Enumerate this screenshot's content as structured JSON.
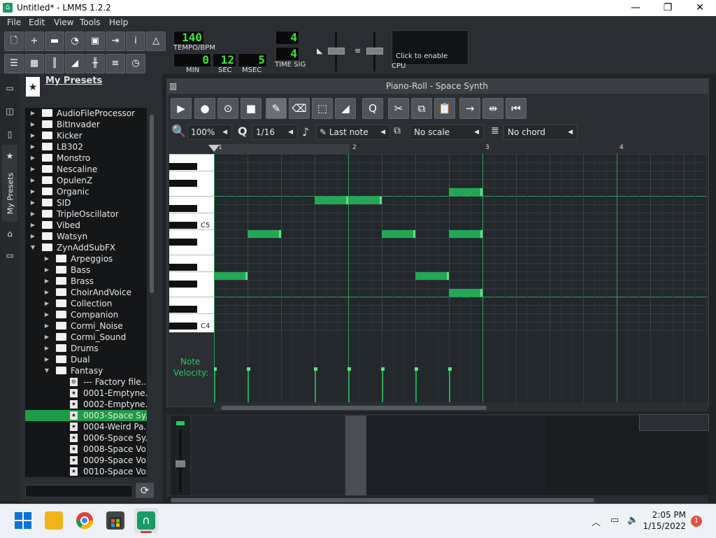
{
  "window": {
    "title": "Untitled* - LMMS 1.2.2",
    "minimize": "—",
    "maximize": "❐",
    "close": "✕"
  },
  "menu": [
    "File",
    "Edit",
    "View",
    "Tools",
    "Help"
  ],
  "transport": {
    "tempo_value": "140",
    "tempo_label": "TEMPO/BPM",
    "min_value": "0",
    "min_label": "MIN",
    "sec_value": "12",
    "sec_label": "SEC",
    "msec_value": "5",
    "msec_label": "MSEC",
    "timesig_num": "4",
    "timesig_den": "4",
    "timesig_label": "TIME SIG",
    "cpu_hint": "Click to enable",
    "cpu_label": "CPU"
  },
  "presets_panel": {
    "title": "My Presets",
    "sidetab_label": "My Presets"
  },
  "tree": [
    {
      "type": "folder",
      "name": "AudioFileProcessor",
      "level": 0,
      "expanded": false
    },
    {
      "type": "folder",
      "name": "BitInvader",
      "level": 0,
      "expanded": false
    },
    {
      "type": "folder",
      "name": "Kicker",
      "level": 0,
      "expanded": false
    },
    {
      "type": "folder",
      "name": "LB302",
      "level": 0,
      "expanded": false
    },
    {
      "type": "folder",
      "name": "Monstro",
      "level": 0,
      "expanded": false
    },
    {
      "type": "folder",
      "name": "Nescaline",
      "level": 0,
      "expanded": false
    },
    {
      "type": "folder",
      "name": "OpulenZ",
      "level": 0,
      "expanded": false
    },
    {
      "type": "folder",
      "name": "Organic",
      "level": 0,
      "expanded": false
    },
    {
      "type": "folder",
      "name": "SID",
      "level": 0,
      "expanded": false
    },
    {
      "type": "folder",
      "name": "TripleOscillator",
      "level": 0,
      "expanded": false
    },
    {
      "type": "folder",
      "name": "Vibed",
      "level": 0,
      "expanded": false
    },
    {
      "type": "folder",
      "name": "Watsyn",
      "level": 0,
      "expanded": false
    },
    {
      "type": "folder",
      "name": "ZynAddSubFX",
      "level": 0,
      "expanded": true
    },
    {
      "type": "folder",
      "name": "Arpeggios",
      "level": 1,
      "expanded": false
    },
    {
      "type": "folder",
      "name": "Bass",
      "level": 1,
      "expanded": false
    },
    {
      "type": "folder",
      "name": "Brass",
      "level": 1,
      "expanded": false
    },
    {
      "type": "folder",
      "name": "ChoirAndVoice",
      "level": 1,
      "expanded": false
    },
    {
      "type": "folder",
      "name": "Collection",
      "level": 1,
      "expanded": false
    },
    {
      "type": "folder",
      "name": "Companion",
      "level": 1,
      "expanded": false
    },
    {
      "type": "folder",
      "name": "Cormi_Noise",
      "level": 1,
      "expanded": false
    },
    {
      "type": "folder",
      "name": "Cormi_Sound",
      "level": 1,
      "expanded": false
    },
    {
      "type": "folder",
      "name": "Drums",
      "level": 1,
      "expanded": false
    },
    {
      "type": "folder",
      "name": "Dual",
      "level": 1,
      "expanded": false
    },
    {
      "type": "folder",
      "name": "Fantasy",
      "level": 1,
      "expanded": true
    },
    {
      "type": "file",
      "name": "--- Factory file...",
      "level": 2,
      "icon": "gear"
    },
    {
      "type": "file",
      "name": "0001-Emptyne...",
      "level": 2,
      "icon": "star"
    },
    {
      "type": "file",
      "name": "0002-Emptyne...",
      "level": 2,
      "icon": "star"
    },
    {
      "type": "file",
      "name": "0003-Space Sy...",
      "level": 2,
      "icon": "star",
      "selected": true
    },
    {
      "type": "file",
      "name": "0004-Weird Pa...",
      "level": 2,
      "icon": "star"
    },
    {
      "type": "file",
      "name": "0006-Space Sy...",
      "level": 2,
      "icon": "star"
    },
    {
      "type": "file",
      "name": "0008-Space Vo...",
      "level": 2,
      "icon": "star"
    },
    {
      "type": "file",
      "name": "0009-Space Vo...",
      "level": 2,
      "icon": "star"
    },
    {
      "type": "file",
      "name": "0010-Space Vo...",
      "level": 2,
      "icon": "star"
    }
  ],
  "piano_roll": {
    "title": "Piano-Roll - Space Synth",
    "zoom": "100%",
    "quantize": "1/16",
    "note_length": "Last note",
    "scale": "No scale",
    "chord": "No chord",
    "ruler_marks": [
      "1",
      "2",
      "3",
      "4"
    ],
    "key_labels": [
      "C5",
      "C4"
    ],
    "velocity_label_1": "Note",
    "velocity_label_2": "Velocity:",
    "notes": [
      {
        "start_step": 0,
        "length_steps": 3,
        "pitch": "D4"
      },
      {
        "start_step": 3,
        "length_steps": 3,
        "pitch": "G4"
      },
      {
        "start_step": 9,
        "length_steps": 3,
        "pitch": "B4"
      },
      {
        "start_step": 12,
        "length_steps": 3,
        "pitch": "B4"
      },
      {
        "start_step": 15,
        "length_steps": 3,
        "pitch": "G4"
      },
      {
        "start_step": 18,
        "length_steps": 3,
        "pitch": "D4"
      },
      {
        "start_step": 21,
        "length_steps": 3,
        "pitch": "C5"
      },
      {
        "start_step": 21,
        "length_steps": 3,
        "pitch": "G4"
      },
      {
        "start_step": 21,
        "length_steps": 3,
        "pitch": "C4"
      }
    ]
  },
  "taskbar": {
    "time": "2:05 PM",
    "date": "1/15/2022",
    "notification_count": "1"
  },
  "colors": {
    "accent_green": "#22a854",
    "lcd_green": "#39e639",
    "selection": "#1e9b48"
  }
}
